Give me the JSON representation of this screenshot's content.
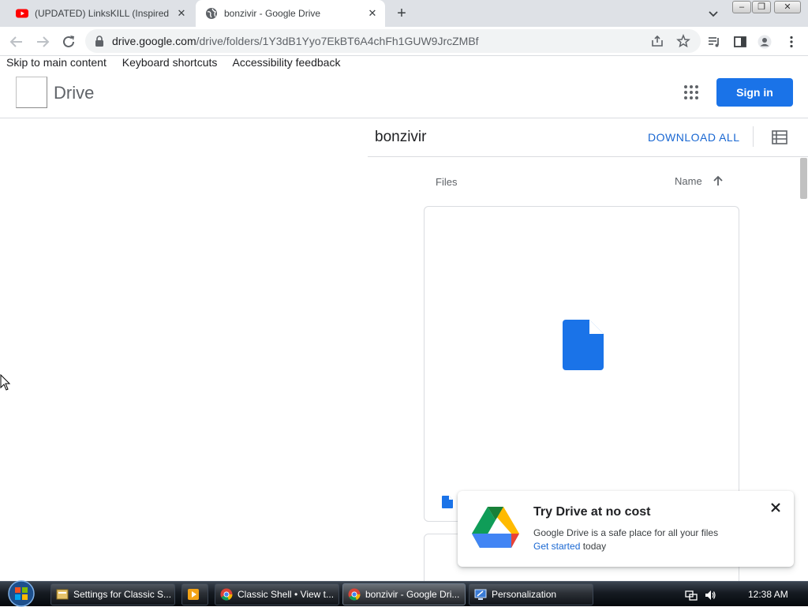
{
  "browser": {
    "tabs": [
      {
        "title": "(UPDATED) LinksKILL (Inspired By",
        "favicon": "youtube-icon",
        "active": false
      },
      {
        "title": "bonzivir - Google Drive",
        "favicon": "globe-icon",
        "active": true
      }
    ],
    "address": {
      "host": "drive.google.com",
      "path": "/drive/folders/1Y3dB1Yyo7EkBT6A4chFh1GUW9JrcZMBf"
    }
  },
  "page": {
    "skip_links": [
      "Skip to main content",
      "Keyboard shortcuts",
      "Accessibility feedback"
    ],
    "header": {
      "product": "Drive",
      "sign_in_label": "Sign in"
    },
    "folder": {
      "title": "bonzivir",
      "download_all_label": "DOWNLOAD ALL"
    },
    "list": {
      "files_label": "Files",
      "sort_label": "Name"
    },
    "promo": {
      "title": "Try Drive at no cost",
      "body": "Google Drive is a safe place for all your files",
      "link": "Get started",
      "link_suffix": " today"
    }
  },
  "taskbar": {
    "items": [
      {
        "label": "Settings for Classic S...",
        "icon": "settings-icon"
      },
      {
        "label": "",
        "icon": "media-player-icon"
      },
      {
        "label": "Classic Shell • View t...",
        "icon": "chrome-icon"
      },
      {
        "label": "bonzivir - Google Dri...",
        "icon": "chrome-icon"
      },
      {
        "label": "Personalization",
        "icon": "personalization-icon"
      }
    ],
    "clock": "12:38 AM"
  },
  "colors": {
    "accent": "#1a73e8",
    "link": "#1967d2",
    "drive_file": "#1a73e8"
  }
}
